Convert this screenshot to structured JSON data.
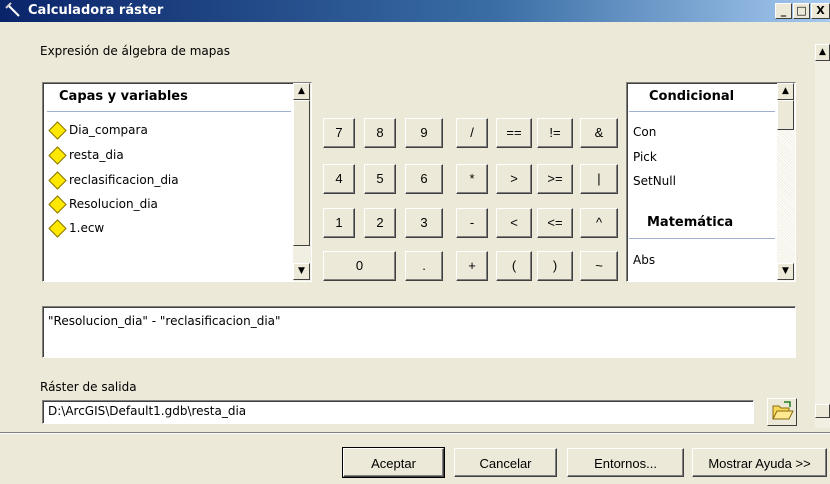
{
  "window": {
    "title": "Calculadora ráster",
    "minimize": "_",
    "maximize": "□",
    "close": "X"
  },
  "expression_group_label": "Expresión de álgebra de mapas",
  "layers": {
    "header": "Capas y variables",
    "items": [
      "Dia_compara",
      "resta_dia",
      "reclasificacion_dia",
      "Resolucion_dia",
      "1.ecw"
    ]
  },
  "keypad": {
    "row1": [
      "7",
      "8",
      "9",
      "/",
      "==",
      "!=",
      "&"
    ],
    "row2": [
      "4",
      "5",
      "6",
      "*",
      ">",
      ">=",
      "|"
    ],
    "row3": [
      "1",
      "2",
      "3",
      "-",
      "<",
      "<=",
      "^"
    ],
    "row4": [
      "0",
      ".",
      "+",
      "(",
      ")",
      "~"
    ]
  },
  "functions": {
    "conditional_header": "Condicional",
    "conditional_items": [
      "Con",
      "Pick",
      "SetNull"
    ],
    "math_header": "Matemática",
    "math_items": [
      "Abs"
    ]
  },
  "expression_value": "\"Resolucion_dia\" - \"reclasificacion_dia\"",
  "output": {
    "label": "Ráster de salida",
    "value": "D:\\ArcGIS\\Default1.gdb\\resta_dia"
  },
  "buttons": {
    "accept": "Aceptar",
    "cancel": "Cancelar",
    "environments": "Entornos...",
    "help": "Mostrar Ayuda >>"
  },
  "icons": {
    "app": "calculator-pick-icon",
    "layer": "raster-layer-diamond-icon",
    "folder": "open-folder-icon"
  },
  "colors": {
    "titlebar": "#0a246a",
    "dialog_bg": "#ece9d8",
    "layer_icon": "#ffe800"
  }
}
